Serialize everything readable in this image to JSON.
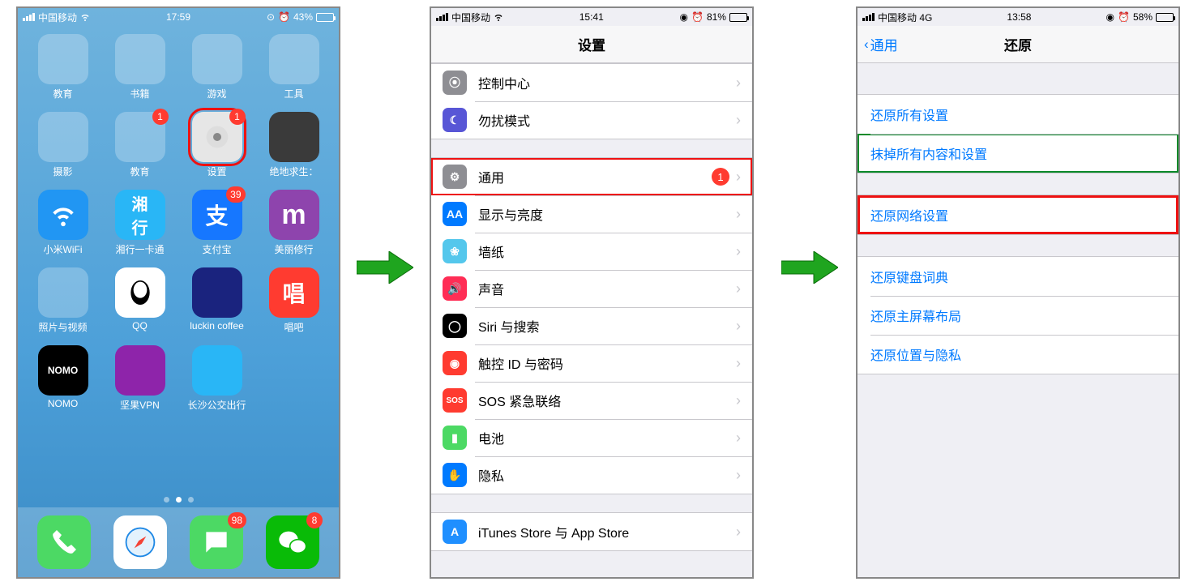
{
  "phone1": {
    "status": {
      "carrier": "中国移动",
      "time": "17:59",
      "battery_text": "43%",
      "battery_pct": 43
    },
    "apps_row1": [
      {
        "label": "教育",
        "type": "folder"
      },
      {
        "label": "书籍",
        "type": "folder"
      },
      {
        "label": "游戏",
        "type": "folder"
      },
      {
        "label": "工具",
        "type": "folder"
      }
    ],
    "apps_row2": [
      {
        "label": "摄影",
        "type": "folder"
      },
      {
        "label": "教育",
        "type": "folder",
        "badge": "1"
      },
      {
        "label": "设置",
        "type": "icon",
        "icon_bg": "#8e8e93",
        "badge": "1",
        "highlight": "red"
      },
      {
        "label": "绝地求生：",
        "type": "icon",
        "icon_bg": "#3a3a3a"
      }
    ],
    "apps_row3": [
      {
        "label": "小米WiFi",
        "type": "icon",
        "icon_bg": "#2196f3"
      },
      {
        "label": "湘行一卡通",
        "type": "icon",
        "icon_bg": "#29b6f6"
      },
      {
        "label": "支付宝",
        "type": "icon",
        "icon_bg": "#1677ff",
        "badge": "39"
      },
      {
        "label": "美丽修行",
        "type": "icon",
        "icon_bg": "#8e44ad"
      }
    ],
    "apps_row4": [
      {
        "label": "照片与视频",
        "type": "folder"
      },
      {
        "label": "QQ",
        "type": "icon",
        "icon_bg": "#ffffff"
      },
      {
        "label": "luckin coffee",
        "type": "icon",
        "icon_bg": "#1a237e"
      },
      {
        "label": "唱吧",
        "type": "icon",
        "icon_bg": "#ff3b30"
      }
    ],
    "apps_row5": [
      {
        "label": "NOMO",
        "type": "icon",
        "icon_bg": "#000000"
      },
      {
        "label": "坚果VPN",
        "type": "icon",
        "icon_bg": "#8e24aa"
      },
      {
        "label": "长沙公交出行",
        "type": "icon",
        "icon_bg": "#29b6f6"
      }
    ],
    "dock": [
      {
        "name": "phone-icon",
        "bg": "#4cd964"
      },
      {
        "name": "safari-icon",
        "bg": "#ffffff"
      },
      {
        "name": "messages-icon",
        "bg": "#4cd964",
        "badge": "98"
      },
      {
        "name": "wechat-icon",
        "bg": "#09bb07",
        "badge": "8"
      }
    ]
  },
  "phone2": {
    "status": {
      "carrier": "中国移动",
      "time": "15:41",
      "battery_text": "81%",
      "battery_pct": 81
    },
    "title": "设置",
    "group1": [
      {
        "icon_bg": "#8e8e93",
        "icon": "⦿",
        "label": "控制中心",
        "name": "control-center"
      },
      {
        "icon_bg": "#5856d6",
        "icon": "☾",
        "label": "勿扰模式",
        "name": "do-not-disturb"
      }
    ],
    "group2": [
      {
        "icon_bg": "#8e8e93",
        "icon": "⚙",
        "label": "通用",
        "badge": "1",
        "name": "general",
        "highlight": "red"
      },
      {
        "icon_bg": "#007aff",
        "icon": "AA",
        "label": "显示与亮度",
        "name": "display-brightness"
      },
      {
        "icon_bg": "#54c7ec",
        "icon": "❀",
        "label": "墙纸",
        "name": "wallpaper"
      },
      {
        "icon_bg": "#ff2d55",
        "icon": "🔊",
        "label": "声音",
        "name": "sounds"
      },
      {
        "icon_bg": "#000000",
        "icon": "◯",
        "label": "Siri 与搜索",
        "name": "siri-search"
      },
      {
        "icon_bg": "#ff3b30",
        "icon": "◉",
        "label": "触控 ID 与密码",
        "name": "touchid-passcode"
      },
      {
        "icon_bg": "#ff3b30",
        "icon": "SOS",
        "label": "SOS 紧急联络",
        "name": "emergency-sos"
      },
      {
        "icon_bg": "#4cd964",
        "icon": "▮",
        "label": "电池",
        "name": "battery"
      },
      {
        "icon_bg": "#007aff",
        "icon": "✋",
        "label": "隐私",
        "name": "privacy"
      }
    ],
    "group3": [
      {
        "icon_bg": "#1f8fff",
        "icon": "A",
        "label": "iTunes Store 与 App Store",
        "name": "itunes-appstore"
      }
    ]
  },
  "phone3": {
    "status": {
      "carrier": "中国移动  4G",
      "time": "13:58",
      "battery_text": "58%",
      "battery_pct": 58
    },
    "back_label": "通用",
    "title": "还原",
    "group1": [
      {
        "label": "还原所有设置",
        "name": "reset-all-settings"
      },
      {
        "label": "抹掉所有内容和设置",
        "name": "erase-all",
        "outline": "green"
      }
    ],
    "group2": [
      {
        "label": "还原网络设置",
        "name": "reset-network",
        "outline": "red"
      }
    ],
    "group3": [
      {
        "label": "还原键盘词典",
        "name": "reset-keyboard-dict"
      },
      {
        "label": "还原主屏幕布局",
        "name": "reset-home-layout"
      },
      {
        "label": "还原位置与隐私",
        "name": "reset-location-privacy"
      }
    ]
  }
}
